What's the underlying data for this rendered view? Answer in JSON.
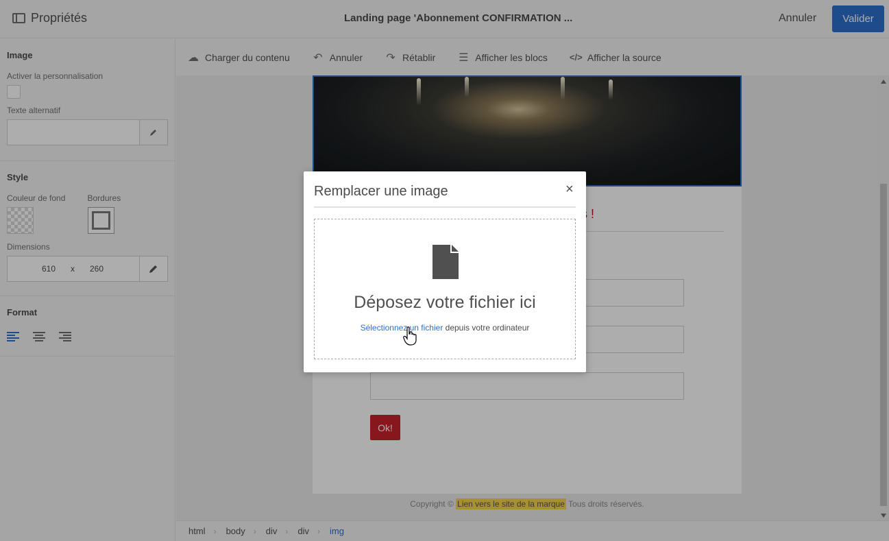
{
  "header": {
    "properties_label": "Propriétés",
    "title": "Landing page 'Abonnement CONFIRMATION ...",
    "cancel_label": "Annuler",
    "validate_label": "Valider"
  },
  "left_panel": {
    "image_section": {
      "title": "Image",
      "personalization_label": "Activer la personnalisation",
      "alt_text_label": "Texte alternatif",
      "alt_text_value": ""
    },
    "style_section": {
      "title": "Style",
      "bg_color_label": "Couleur de fond",
      "borders_label": "Bordures",
      "dimensions_label": "Dimensions",
      "width_value": "610",
      "separator": "x",
      "height_value": "260"
    },
    "format_section": {
      "title": "Format",
      "alignments": [
        "left",
        "center",
        "right"
      ],
      "active_alignment": "left"
    }
  },
  "toolbar": {
    "items": [
      {
        "icon": "cloud-upload-icon",
        "label": "Charger du contenu"
      },
      {
        "icon": "undo-icon",
        "label": "Annuler"
      },
      {
        "icon": "redo-icon",
        "label": "Rétablir"
      },
      {
        "icon": "blocks-icon",
        "label": "Afficher les blocs"
      },
      {
        "icon": "code-icon",
        "label": "Afficher la source"
      }
    ]
  },
  "canvas": {
    "heading_fragment": "s !",
    "ok_button": "Ok!",
    "copyright_prefix": "Copyright ©",
    "copyright_link": "Lien vers le site de la marque",
    "copyright_suffix": "Tous droits réservés."
  },
  "breadcrumb": [
    "html",
    "body",
    "div",
    "div",
    "img"
  ],
  "modal": {
    "title": "Remplacer une image",
    "close": "×",
    "drop_title": "Déposez votre fichier ici",
    "select_link": "Sélectionnez un fichier",
    "select_suffix": " depuis votre ordinateur"
  },
  "colors": {
    "accent": "#2d6fcc",
    "ok_button": "#c8222a",
    "heading_red": "#d0021b",
    "highlight": "#f5d54b"
  }
}
